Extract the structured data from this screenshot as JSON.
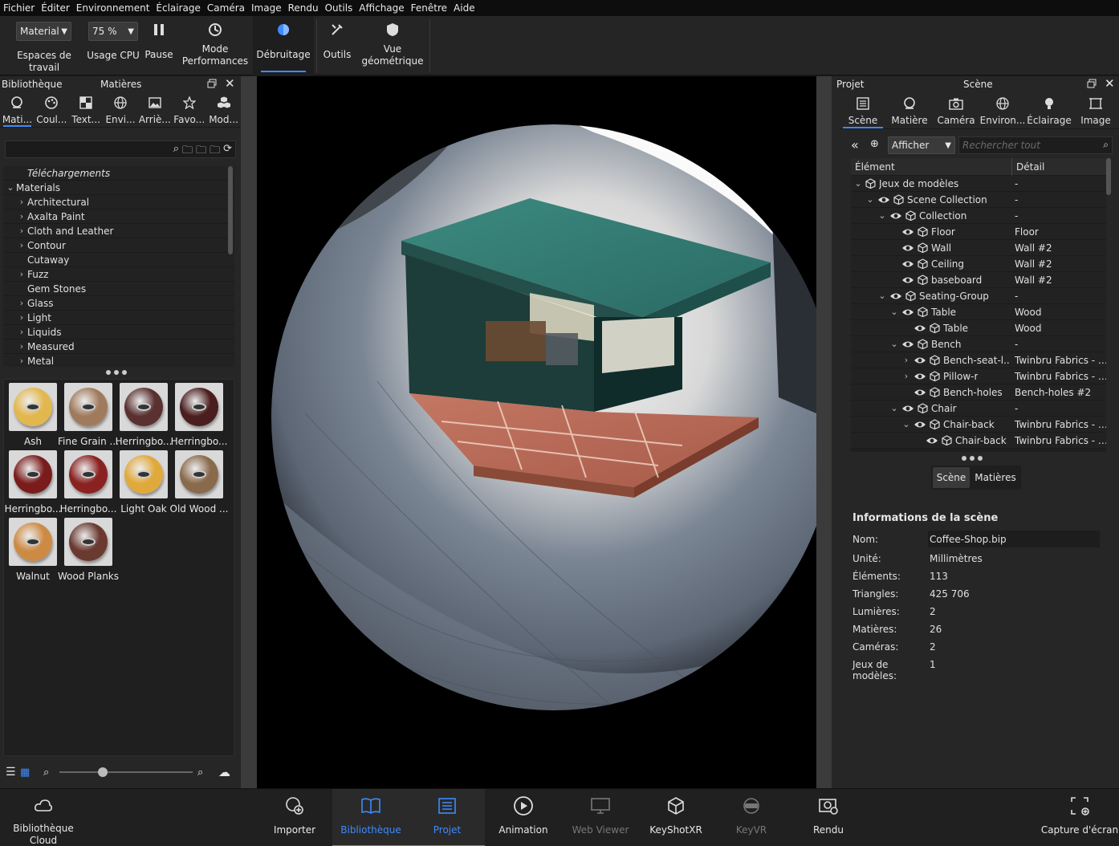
{
  "menu": [
    "Fichier",
    "Éditer",
    "Environnement",
    "Éclairage",
    "Caméra",
    "Image",
    "Rendu",
    "Outils",
    "Affichage",
    "Fenêtre",
    "Aide"
  ],
  "toolbar": {
    "workspace_select": "Material",
    "workspace_label": "Espaces de travail",
    "cpu_select": "75 %",
    "cpu_label": "Usage CPU",
    "pause_label": "Pause",
    "perf_label_1": "Mode",
    "perf_label_2": "Performances",
    "denoise_label": "Débruitage",
    "tools_label": "Outils",
    "geo_label_1": "Vue",
    "geo_label_2": "géométrique"
  },
  "left_panel": {
    "title_library": "Bibliothèque",
    "title_materials": "Matières",
    "tabs": [
      {
        "label": "Mati...",
        "icon": "sphere-icon"
      },
      {
        "label": "Coul...",
        "icon": "palette-icon"
      },
      {
        "label": "Text...",
        "icon": "checker-icon"
      },
      {
        "label": "Envi...",
        "icon": "globe-icon"
      },
      {
        "label": "Arriè...",
        "icon": "picture-icon"
      },
      {
        "label": "Favo...",
        "icon": "star-icon"
      },
      {
        "label": "Mod...",
        "icon": "cubes-icon"
      }
    ],
    "tree": [
      {
        "label": "Téléchargements",
        "chev": "",
        "indent": 1,
        "italic": true
      },
      {
        "label": "Materials",
        "chev": "⌄",
        "indent": 0
      },
      {
        "label": "Architectural",
        "chev": "›",
        "indent": 1
      },
      {
        "label": "Axalta Paint",
        "chev": "›",
        "indent": 1
      },
      {
        "label": "Cloth and Leather",
        "chev": "›",
        "indent": 1
      },
      {
        "label": "Contour",
        "chev": "›",
        "indent": 1
      },
      {
        "label": "Cutaway",
        "chev": "",
        "indent": 1
      },
      {
        "label": "Fuzz",
        "chev": "›",
        "indent": 1
      },
      {
        "label": "Gem Stones",
        "chev": "",
        "indent": 1
      },
      {
        "label": "Glass",
        "chev": "›",
        "indent": 1
      },
      {
        "label": "Light",
        "chev": "›",
        "indent": 1
      },
      {
        "label": "Liquids",
        "chev": "›",
        "indent": 1
      },
      {
        "label": "Measured",
        "chev": "›",
        "indent": 1
      },
      {
        "label": "Metal",
        "chev": "›",
        "indent": 1
      }
    ],
    "thumbnails": [
      {
        "label": "Ash",
        "color": "#e2b74e"
      },
      {
        "label": "Fine Grain ...",
        "color": "#a07a5c"
      },
      {
        "label": "Herringbo...",
        "color": "#5a3030"
      },
      {
        "label": "Herringbo...",
        "color": "#4a1e1e"
      },
      {
        "label": "Herringbo...",
        "color": "#7a1c1c"
      },
      {
        "label": "Herringbo...",
        "color": "#8a2222"
      },
      {
        "label": "Light Oak",
        "color": "#e0a93c"
      },
      {
        "label": "Old Wood ...",
        "color": "#8a6a4c"
      },
      {
        "label": "Walnut",
        "color": "#cd8a44"
      },
      {
        "label": "Wood Planks",
        "color": "#6a3a30"
      }
    ]
  },
  "right_panel": {
    "title_project": "Projet",
    "title_scene": "Scène",
    "tabs": [
      {
        "label": "Scène",
        "icon": "list-icon"
      },
      {
        "label": "Matière",
        "icon": "sphere-icon"
      },
      {
        "label": "Caméra",
        "icon": "camera-icon"
      },
      {
        "label": "Environ...",
        "icon": "globe-icon"
      },
      {
        "label": "Éclairage",
        "icon": "bulb-icon"
      },
      {
        "label": "Image",
        "icon": "frame-icon"
      }
    ],
    "filter_select": "Afficher",
    "search_placeholder": "Rechercher tout",
    "col_element": "Élément",
    "col_detail": "Détail",
    "tree": [
      {
        "label": "Jeux de modèles",
        "detail": "-",
        "indent": 0,
        "chev": "⌄",
        "eye": false
      },
      {
        "label": "Scene Collection",
        "detail": "-",
        "indent": 1,
        "chev": "⌄",
        "eye": true
      },
      {
        "label": "Collection",
        "detail": "-",
        "indent": 2,
        "chev": "⌄",
        "eye": true
      },
      {
        "label": "Floor",
        "detail": "Floor",
        "indent": 3,
        "chev": "",
        "eye": true
      },
      {
        "label": "Wall",
        "detail": "Wall #2",
        "indent": 3,
        "chev": "",
        "eye": true
      },
      {
        "label": "Ceiling",
        "detail": "Wall #2",
        "indent": 3,
        "chev": "",
        "eye": true
      },
      {
        "label": "baseboard",
        "detail": "Wall #2",
        "indent": 3,
        "chev": "",
        "eye": true
      },
      {
        "label": "Seating-Group",
        "detail": "-",
        "indent": 2,
        "chev": "⌄",
        "eye": true
      },
      {
        "label": "Table",
        "detail": "Wood",
        "indent": 3,
        "chev": "⌄",
        "eye": true
      },
      {
        "label": "Table",
        "detail": "Wood",
        "indent": 4,
        "chev": "",
        "eye": true
      },
      {
        "label": "Bench",
        "detail": "-",
        "indent": 3,
        "chev": "⌄",
        "eye": true
      },
      {
        "label": "Bench-seat-l...",
        "detail": "Twinbru Fabrics - St...",
        "indent": 4,
        "chev": "›",
        "eye": true
      },
      {
        "label": "Pillow-r",
        "detail": "Twinbru Fabrics - St...",
        "indent": 4,
        "chev": "›",
        "eye": true
      },
      {
        "label": "Bench-holes",
        "detail": "Bench-holes #2",
        "indent": 4,
        "chev": "",
        "eye": true
      },
      {
        "label": "Chair",
        "detail": "-",
        "indent": 3,
        "chev": "⌄",
        "eye": true
      },
      {
        "label": "Chair-back",
        "detail": "Twinbru Fabrics - St...",
        "indent": 4,
        "chev": "⌄",
        "eye": true
      },
      {
        "label": "Chair-back",
        "detail": "Twinbru Fabrics - St...",
        "indent": 5,
        "chev": "",
        "eye": true
      }
    ],
    "toggle_scene": "Scène",
    "toggle_materials": "Matières",
    "info_title": "Informations de la scène",
    "info": {
      "name_label": "Nom:",
      "name_value": "Coffee-Shop.bip",
      "unit_label": "Unité:",
      "unit_value": "Millimètres",
      "elements_label": "Éléments:",
      "elements_value": "113",
      "triangles_label": "Triangles:",
      "triangles_value": "425 706",
      "lights_label": "Lumières:",
      "lights_value": "2",
      "materials_label": "Matières:",
      "materials_value": "26",
      "cameras_label": "Caméras:",
      "cameras_value": "2",
      "modelsets_label": "Jeux de modèles:",
      "modelsets_value": "1"
    }
  },
  "bottom_bar": {
    "cloud_1": "Bibliothèque",
    "cloud_2": "Cloud",
    "import": "Importer",
    "library": "Bibliothèque",
    "project": "Projet",
    "animation": "Animation",
    "webviewer": "Web Viewer",
    "keyshotxr": "KeyShotXR",
    "keyvr": "KeyVR",
    "render": "Rendu",
    "screenshot": "Capture d'écran"
  },
  "colors": {
    "accent": "#3d8bfd"
  }
}
